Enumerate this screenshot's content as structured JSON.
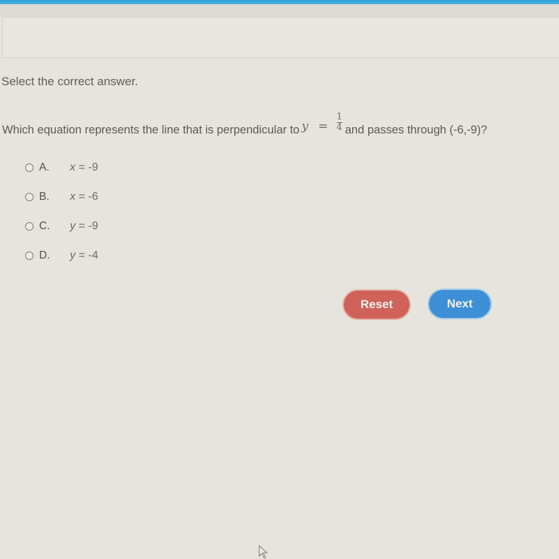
{
  "header": {
    "accent_color": "#2b9fd6"
  },
  "instruction": "Select the correct answer.",
  "question": {
    "prefix": "Which equation represents the line that is perpendicular to",
    "equation": {
      "variable": "y",
      "operator": "=",
      "numerator": "1",
      "denominator": "4"
    },
    "suffix": "and passes through (-6,-9)?"
  },
  "options": [
    {
      "letter": "A.",
      "variable": "x",
      "rest": "= -9",
      "selected": false
    },
    {
      "letter": "B.",
      "variable": "x",
      "rest": "= -6",
      "selected": false
    },
    {
      "letter": "C.",
      "variable": "y",
      "rest": "= -9",
      "selected": false
    },
    {
      "letter": "D.",
      "variable": "y",
      "rest": "= -4",
      "selected": false
    }
  ],
  "buttons": {
    "reset_label": "Reset",
    "reset_color": "#d0625a",
    "next_label": "Next",
    "next_color": "#3d8fd6"
  },
  "cursor": {
    "icon": "mouse-pointer-icon"
  }
}
